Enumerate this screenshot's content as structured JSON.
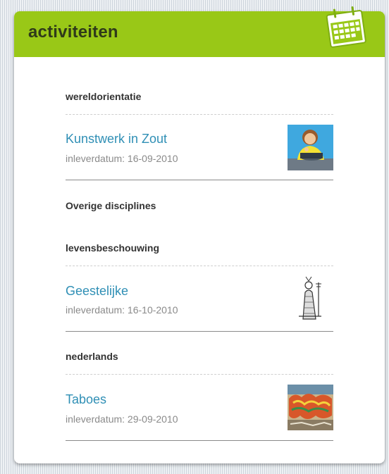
{
  "widget": {
    "title": "activiteiten",
    "icon": "calendar-icon",
    "accent_color": "#99c817",
    "link_color": "#2f8fb5"
  },
  "sections": [
    {
      "heading": "wereldorientatie",
      "activities": [
        {
          "title": "Kunstwerk in Zout",
          "date": "inleverdatum: 16-09-2010",
          "image": "cooking-illustration"
        }
      ]
    },
    {
      "heading": "Overige disciplines",
      "activities": []
    },
    {
      "heading": "levensbeschouwing",
      "activities": [
        {
          "title": "Geestelijke",
          "date": "inleverdatum: 16-10-2010",
          "image": "religious-figure-engraving"
        }
      ]
    },
    {
      "heading": "nederlands",
      "activities": [
        {
          "title": "Taboes",
          "date": "inleverdatum: 29-09-2010",
          "image": "graffiti-image"
        }
      ]
    }
  ]
}
